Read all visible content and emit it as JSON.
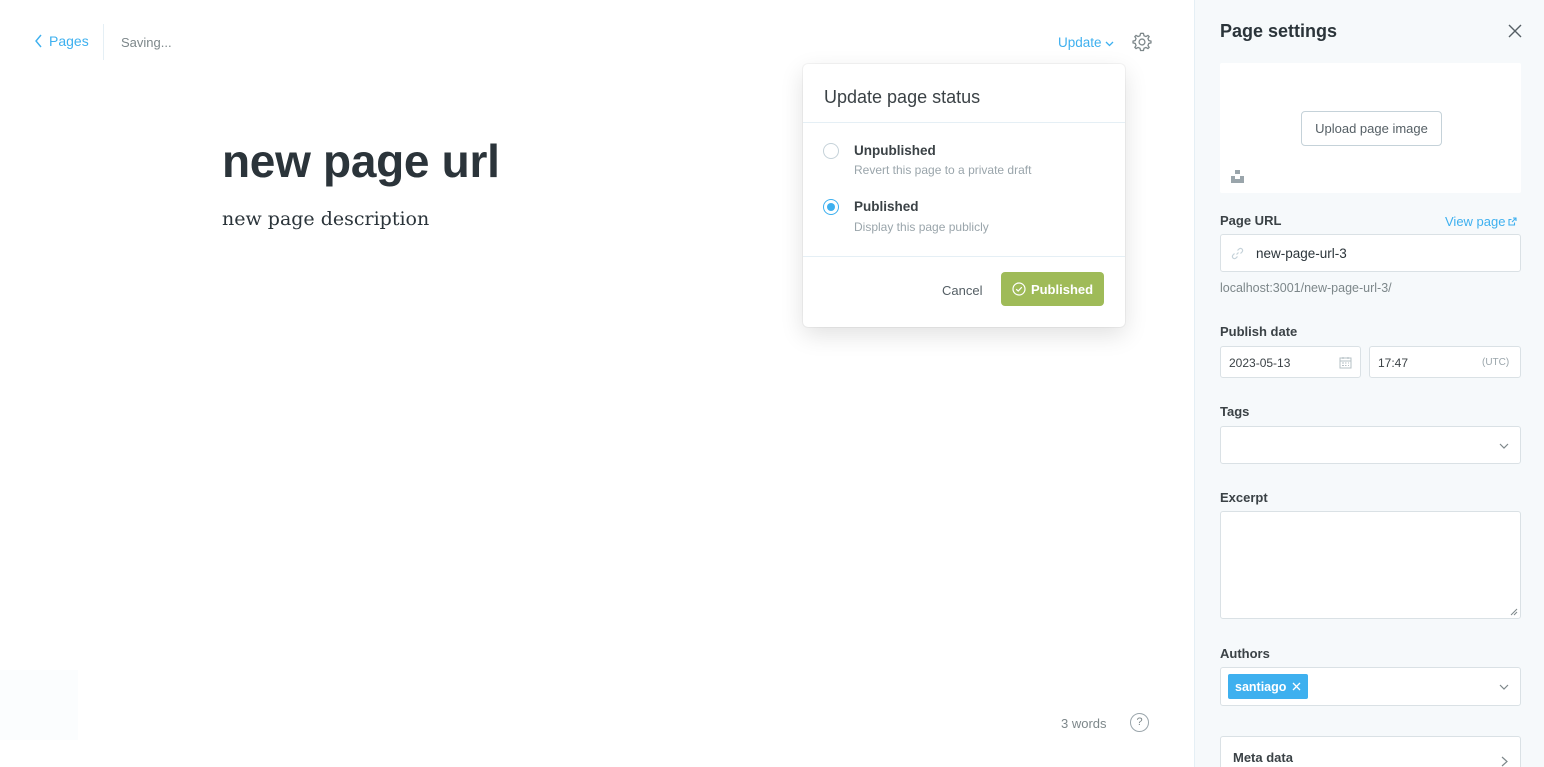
{
  "editor": {
    "back_label": "Pages",
    "status_text": "Saving...",
    "update_label": "Update",
    "title": "new page url",
    "description": "new page description",
    "word_count": "3 words",
    "help_label": "?"
  },
  "popover": {
    "title": "Update page status",
    "options": [
      {
        "label": "Unpublished",
        "sub": "Revert this page to a private draft",
        "checked": false
      },
      {
        "label": "Published",
        "sub": "Display this page publicly",
        "checked": true
      }
    ],
    "cancel_label": "Cancel",
    "confirm_label": "Published"
  },
  "settings": {
    "title": "Page settings",
    "upload_label": "Upload page image",
    "url_label": "Page URL",
    "view_page_label": "View page",
    "url_value": "new-page-url-3",
    "url_hint": "localhost:3001/new-page-url-3/",
    "publish_date_label": "Publish date",
    "date_value": "2023-05-13",
    "time_value": "17:47",
    "timezone": "(UTC)",
    "tags_label": "Tags",
    "excerpt_label": "Excerpt",
    "authors_label": "Authors",
    "author_name": "santiago",
    "meta_label": "Meta data"
  },
  "colors": {
    "accent": "#3eb0ef",
    "publish_green": "#9fbb58",
    "panel_bg": "#f6f9fb"
  }
}
